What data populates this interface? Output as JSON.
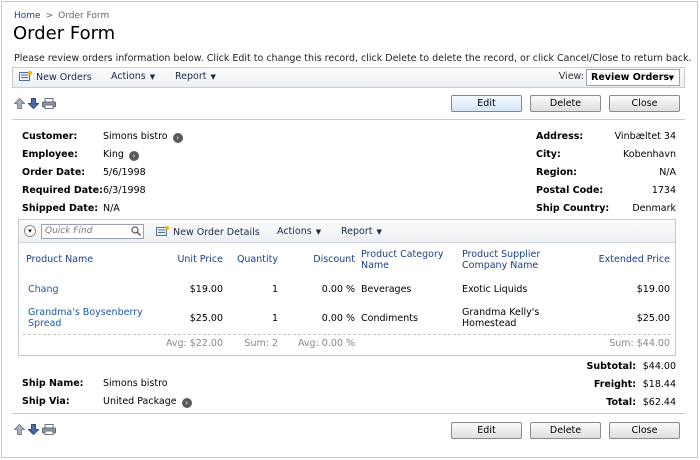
{
  "breadcrumb": {
    "home": "Home",
    "separator": ">",
    "current": "Order Form"
  },
  "page_title": "Order Form",
  "description": "Please review orders information below. Click Edit to change this record, click Delete to delete the record, or click Cancel/Close to return back.",
  "toolbar": {
    "new_orders": "New Orders",
    "actions": "Actions",
    "report": "Report",
    "view_label": "View:",
    "view_value": "Review Orders"
  },
  "buttons": {
    "edit": "Edit",
    "delete": "Delete",
    "close": "Close"
  },
  "fields": {
    "customer_label": "Customer:",
    "customer": "Simons bistro",
    "employee_label": "Employee:",
    "employee": "King",
    "order_date_label": "Order Date:",
    "order_date": "5/6/1998",
    "required_date_label": "Required Date:",
    "required_date": "6/3/1998",
    "shipped_date_label": "Shipped Date:",
    "shipped_date": "N/A",
    "address_label": "Address:",
    "address": "Vinbæltet 34",
    "city_label": "City:",
    "city": "Kobenhavn",
    "region_label": "Region:",
    "region": "N/A",
    "postal_code_label": "Postal Code:",
    "postal_code": "1734",
    "ship_country_label": "Ship Country:",
    "ship_country": "Denmark"
  },
  "details": {
    "quick_find_placeholder": "Quick Find",
    "new_order_details": "New Order Details",
    "actions": "Actions",
    "report": "Report",
    "columns": {
      "product_name": "Product Name",
      "unit_price": "Unit Price",
      "quantity": "Quantity",
      "discount": "Discount",
      "category": "Product Category Name",
      "supplier": "Product Supplier Company Name",
      "extended_price": "Extended Price"
    },
    "rows": [
      {
        "product": "Chang",
        "unit_price": "$19.00",
        "quantity": "1",
        "discount": "0.00 %",
        "category": "Beverages",
        "supplier": "Exotic Liquids",
        "extended_price": "$19.00"
      },
      {
        "product": "Grandma's Boysenberry Spread",
        "unit_price": "$25.00",
        "quantity": "1",
        "discount": "0.00 %",
        "category": "Condiments",
        "supplier": "Grandma Kelly's Homestead",
        "extended_price": "$25.00"
      }
    ],
    "aggregates": {
      "unit_price": "Avg: $22.00",
      "quantity": "Sum: 2",
      "discount": "Avg: 0.00 %",
      "extended_price": "Sum: $44.00"
    }
  },
  "totals": {
    "subtotal_label": "Subtotal:",
    "subtotal": "$44.00",
    "freight_label": "Freight:",
    "freight": "$18.44",
    "total_label": "Total:",
    "total": "$62.44"
  },
  "shipping": {
    "ship_name_label": "Ship Name:",
    "ship_name": "Simons bistro",
    "ship_via_label": "Ship Via:",
    "ship_via": "United Package"
  }
}
